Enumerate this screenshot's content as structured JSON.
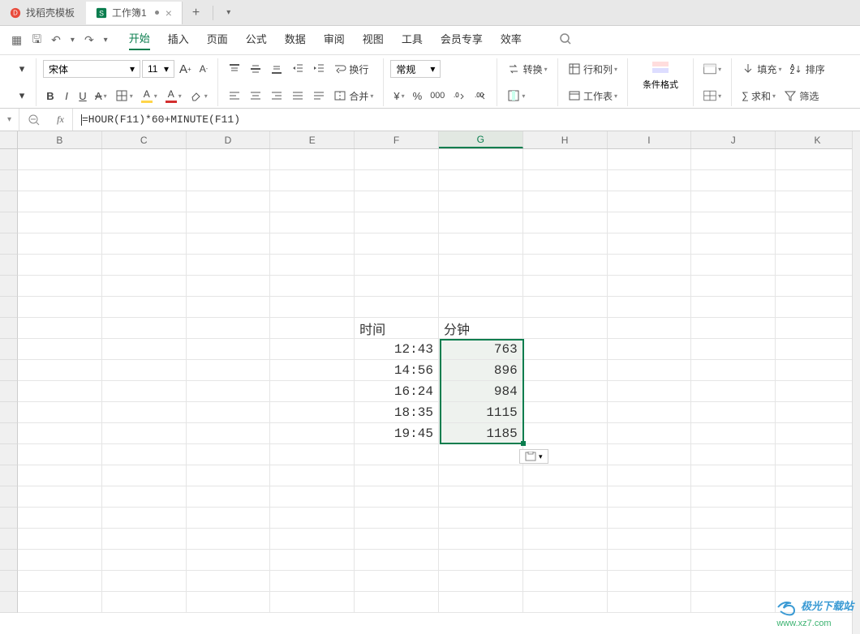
{
  "tabs": {
    "tab1": {
      "label": "找稻壳模板",
      "icon_color": "#e84a3b"
    },
    "tab2": {
      "label": "工作簿1",
      "icon_bg": "#0a7d4e",
      "icon_text": "S"
    }
  },
  "menu": {
    "start": "开始",
    "insert": "插入",
    "page": "页面",
    "formula": "公式",
    "data": "数据",
    "review": "审阅",
    "view": "视图",
    "tools": "工具",
    "member": "会员专享",
    "efficiency": "效率"
  },
  "ribbon": {
    "font_name": "宋体",
    "font_size": "11",
    "bold": "B",
    "italic": "I",
    "underline": "U",
    "strike": "A",
    "wrap": "换行",
    "merge": "合并",
    "num_format": "常规",
    "convert": "转换",
    "row_col": "行和列",
    "sheet": "工作表",
    "cond_format": "条件格式",
    "fill": "填充",
    "sort": "排序",
    "sum": "求和",
    "filter": "筛选"
  },
  "formula_bar": {
    "formula": "=HOUR(F11)*60+MINUTE(F11)"
  },
  "columns": [
    "B",
    "C",
    "D",
    "E",
    "F",
    "G",
    "H",
    "I",
    "J",
    "K"
  ],
  "sheet": {
    "header_time": "时间",
    "header_minute": "分钟",
    "rows": [
      {
        "time": "12:43",
        "minute": "763"
      },
      {
        "time": "14:56",
        "minute": "896"
      },
      {
        "time": "16:24",
        "minute": "984"
      },
      {
        "time": "18:35",
        "minute": "1115"
      },
      {
        "time": "19:45",
        "minute": "1185"
      }
    ]
  },
  "watermark": {
    "brand": "极光下载站",
    "url": "www.xz7.com"
  }
}
